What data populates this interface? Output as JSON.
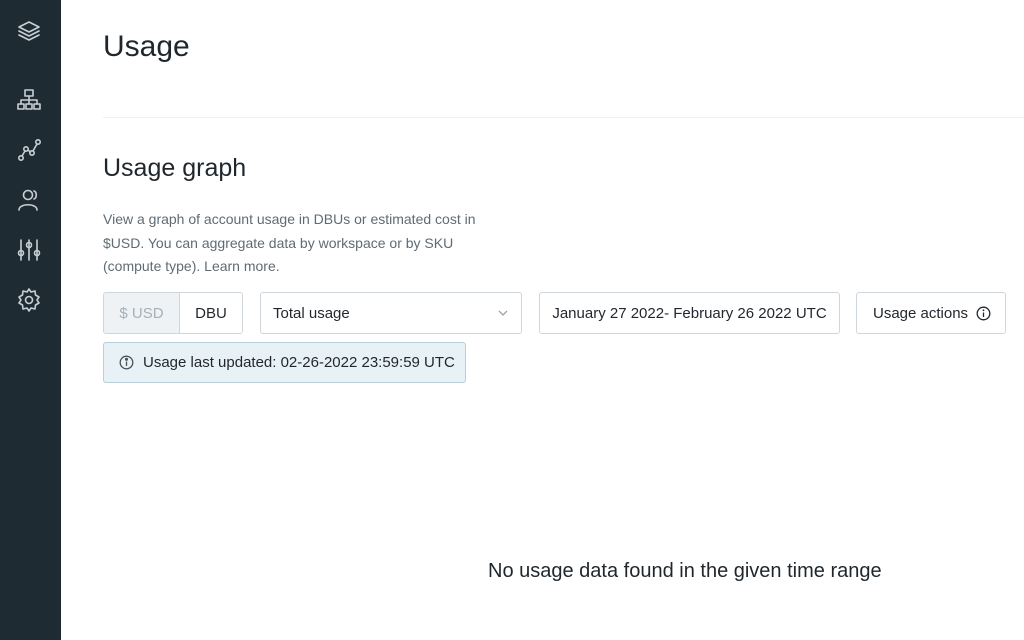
{
  "sidebar": {
    "items": [
      {
        "icon": "layers-icon"
      },
      {
        "icon": "workspaces-icon"
      },
      {
        "icon": "data-icon"
      },
      {
        "icon": "user-icon"
      },
      {
        "icon": "settings-sliders-icon"
      },
      {
        "icon": "gear-icon"
      }
    ]
  },
  "page": {
    "title": "Usage"
  },
  "usage_graph": {
    "title": "Usage graph",
    "description": "View a graph of account usage in DBUs or estimated cost in $USD. You can aggregate data by workspace or by SKU (compute type).",
    "learn_more": "Learn more.",
    "unit_toggle": {
      "usd_label": "$ USD",
      "dbu_label": "DBU",
      "selected": "DBU"
    },
    "aggregation_select": {
      "value": "Total usage"
    },
    "date_range": "January 27 2022- February 26 2022 UTC",
    "actions_label": "Usage actions",
    "banner": "Usage last updated: 02-26-2022 23:59:59 UTC",
    "empty_message": "No usage data found in the given time range"
  },
  "colors": {
    "sidebar_bg": "#1f2b33",
    "banner_bg": "#e8f1f6",
    "text_primary": "#1f272d",
    "text_secondary": "#5f6b73"
  }
}
